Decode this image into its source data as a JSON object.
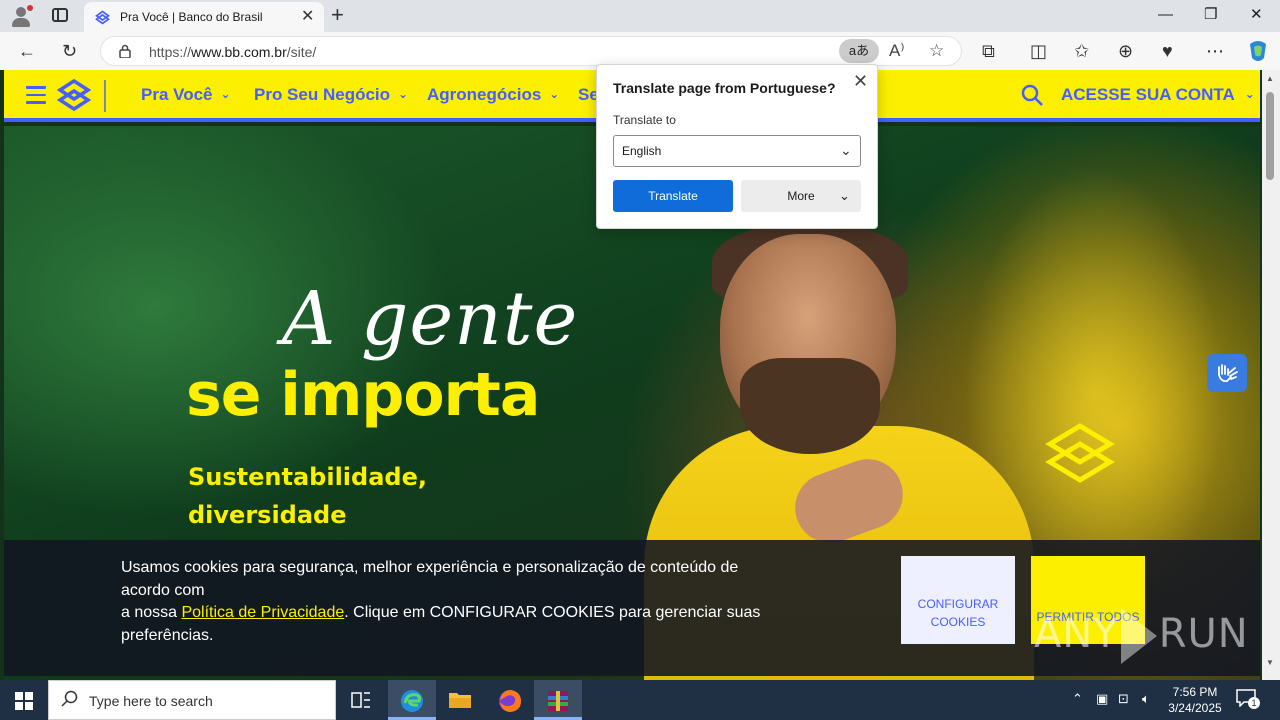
{
  "browser": {
    "tab_title": "Pra Você | Banco do Brasil",
    "url_prefix": "https://",
    "url_domain": "www.bb.com.br",
    "url_path": "/site/",
    "translate_pill": "aあ"
  },
  "translate_popup": {
    "title": "Translate page from Portuguese?",
    "label": "Translate to",
    "selected_language": "English",
    "translate_button": "Translate",
    "more_button": "More"
  },
  "site_nav": {
    "items": [
      {
        "label": "Pra Você"
      },
      {
        "label": "Pro Seu Negócio"
      },
      {
        "label": "Agronegócios"
      },
      {
        "label": "Se"
      }
    ],
    "account_label": "ACESSE SUA CONTA"
  },
  "hero": {
    "script_text": "A gente",
    "bold_text": "se importa",
    "sub_line1": "Sustentabilidade,",
    "sub_line2": "diversidade"
  },
  "cookie_banner": {
    "text_part1": "Usamos cookies para segurança, melhor experiência e personalização de conteúdo de acordo com",
    "text_part2": "a nossa ",
    "privacy_link": "Política de Privacidade",
    "text_part3": ". Clique em CONFIGURAR COOKIES para gerenciar suas preferências.",
    "config_button": "CONFIGURAR COOKIES",
    "permit_button": "PERMITIR TODOS"
  },
  "watermark": {
    "left": "ANY",
    "right": "RUN"
  },
  "taskbar": {
    "search_placeholder": "Type here to search",
    "time": "7:56 PM",
    "date": "3/24/2025",
    "notification_count": "1"
  },
  "colors": {
    "bb_yellow": "#fcf000",
    "bb_blue": "#465eff",
    "edge_blue": "#0f6cd9"
  }
}
